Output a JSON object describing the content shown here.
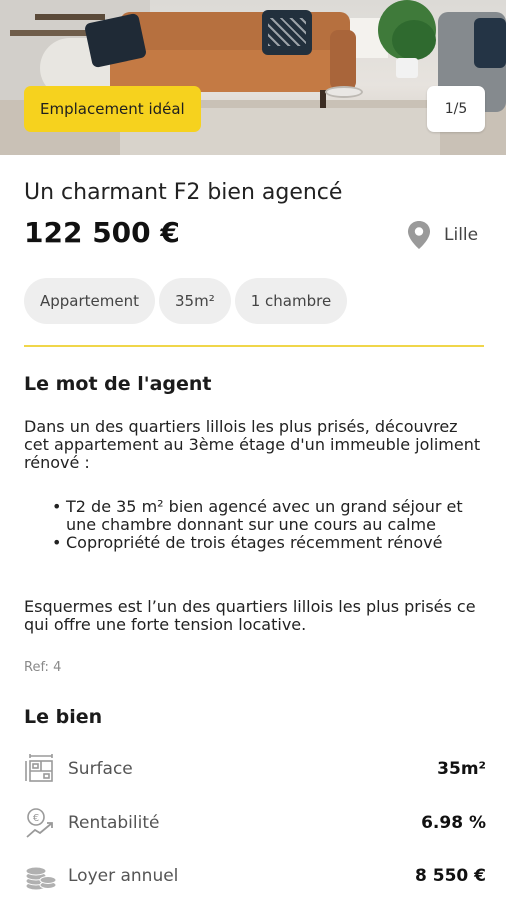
{
  "hero": {
    "tag": "Emplacement idéal",
    "counter": "1/5"
  },
  "listing": {
    "title": "Un charmant F2 bien agencé",
    "price": "122 500 €",
    "city": "Lille",
    "chips": [
      "Appartement",
      "35m²",
      "1 chambre"
    ]
  },
  "agent": {
    "heading": "Le mot de l'agent",
    "intro": "Dans un des quartiers lillois les plus prisés, découvrez cet appartement au 3ème étage d'un immeuble joliment rénové :",
    "bullets": [
      "T2 de 35 m² bien agencé avec un grand séjour et une chambre donnant sur une cours au calme",
      "Copropriété de trois étages récemment rénové"
    ],
    "outro": "Esquermes est l’un des quartiers lillois les plus prisés ce qui offre une forte tension locative.",
    "ref": "Ref: 4"
  },
  "property": {
    "heading": "Le bien",
    "features": [
      {
        "icon": "surface-icon",
        "label": "Surface",
        "value": "35m²"
      },
      {
        "icon": "rentability-icon",
        "label": "Rentabilité",
        "value": "6.98 %"
      },
      {
        "icon": "coins-icon",
        "label": "Loyer annuel",
        "value": "8 550 €"
      }
    ]
  },
  "colors": {
    "accent": "#f6d21e",
    "divider": "#f0d64a",
    "icon": "#9a9a9a"
  }
}
